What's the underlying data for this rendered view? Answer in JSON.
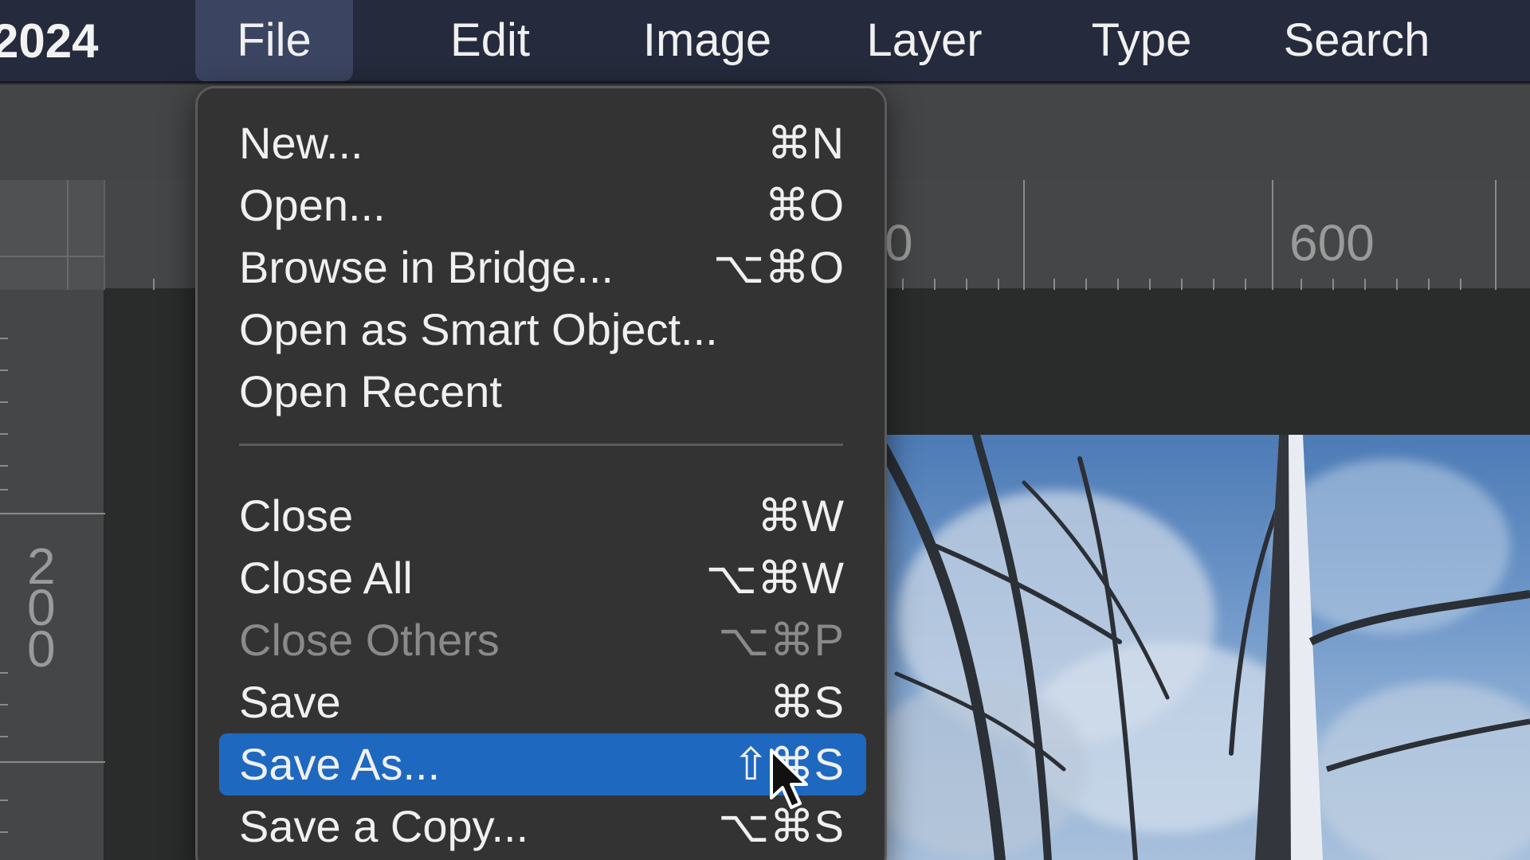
{
  "app": {
    "title": "2024"
  },
  "menubar": {
    "items": [
      {
        "label": "File",
        "active": true
      },
      {
        "label": "Edit"
      },
      {
        "label": "Image"
      },
      {
        "label": "Layer"
      },
      {
        "label": "Type"
      },
      {
        "label": "Search"
      }
    ]
  },
  "rulers": {
    "horizontal_labels": [
      "0",
      "600"
    ],
    "vertical_labels": [
      "2",
      "0",
      "0"
    ]
  },
  "file_menu": {
    "items": [
      {
        "label": "New...",
        "shortcut": "⌘N"
      },
      {
        "label": "Open...",
        "shortcut": "⌘O"
      },
      {
        "label": "Browse in Bridge...",
        "shortcut": "⌥⌘O"
      },
      {
        "label": "Open as Smart Object...",
        "shortcut": ""
      },
      {
        "label": "Open Recent",
        "shortcut": ""
      },
      {
        "label": "Close",
        "shortcut": "⌘W"
      },
      {
        "label": "Close All",
        "shortcut": "⌥⌘W"
      },
      {
        "label": "Close Others",
        "shortcut": "⌥⌘P",
        "disabled": true
      },
      {
        "label": "Save",
        "shortcut": "⌘S"
      },
      {
        "label": "Save As...",
        "shortcut": "⇧⌘S",
        "highlighted": true
      },
      {
        "label": "Save a Copy...",
        "shortcut": "⌥⌘S"
      }
    ]
  },
  "colors": {
    "menubar_bg": "#252a3c",
    "menu_bg": "#333334",
    "highlight": "#1e68c0",
    "disabled_text": "#8a8a8a"
  }
}
